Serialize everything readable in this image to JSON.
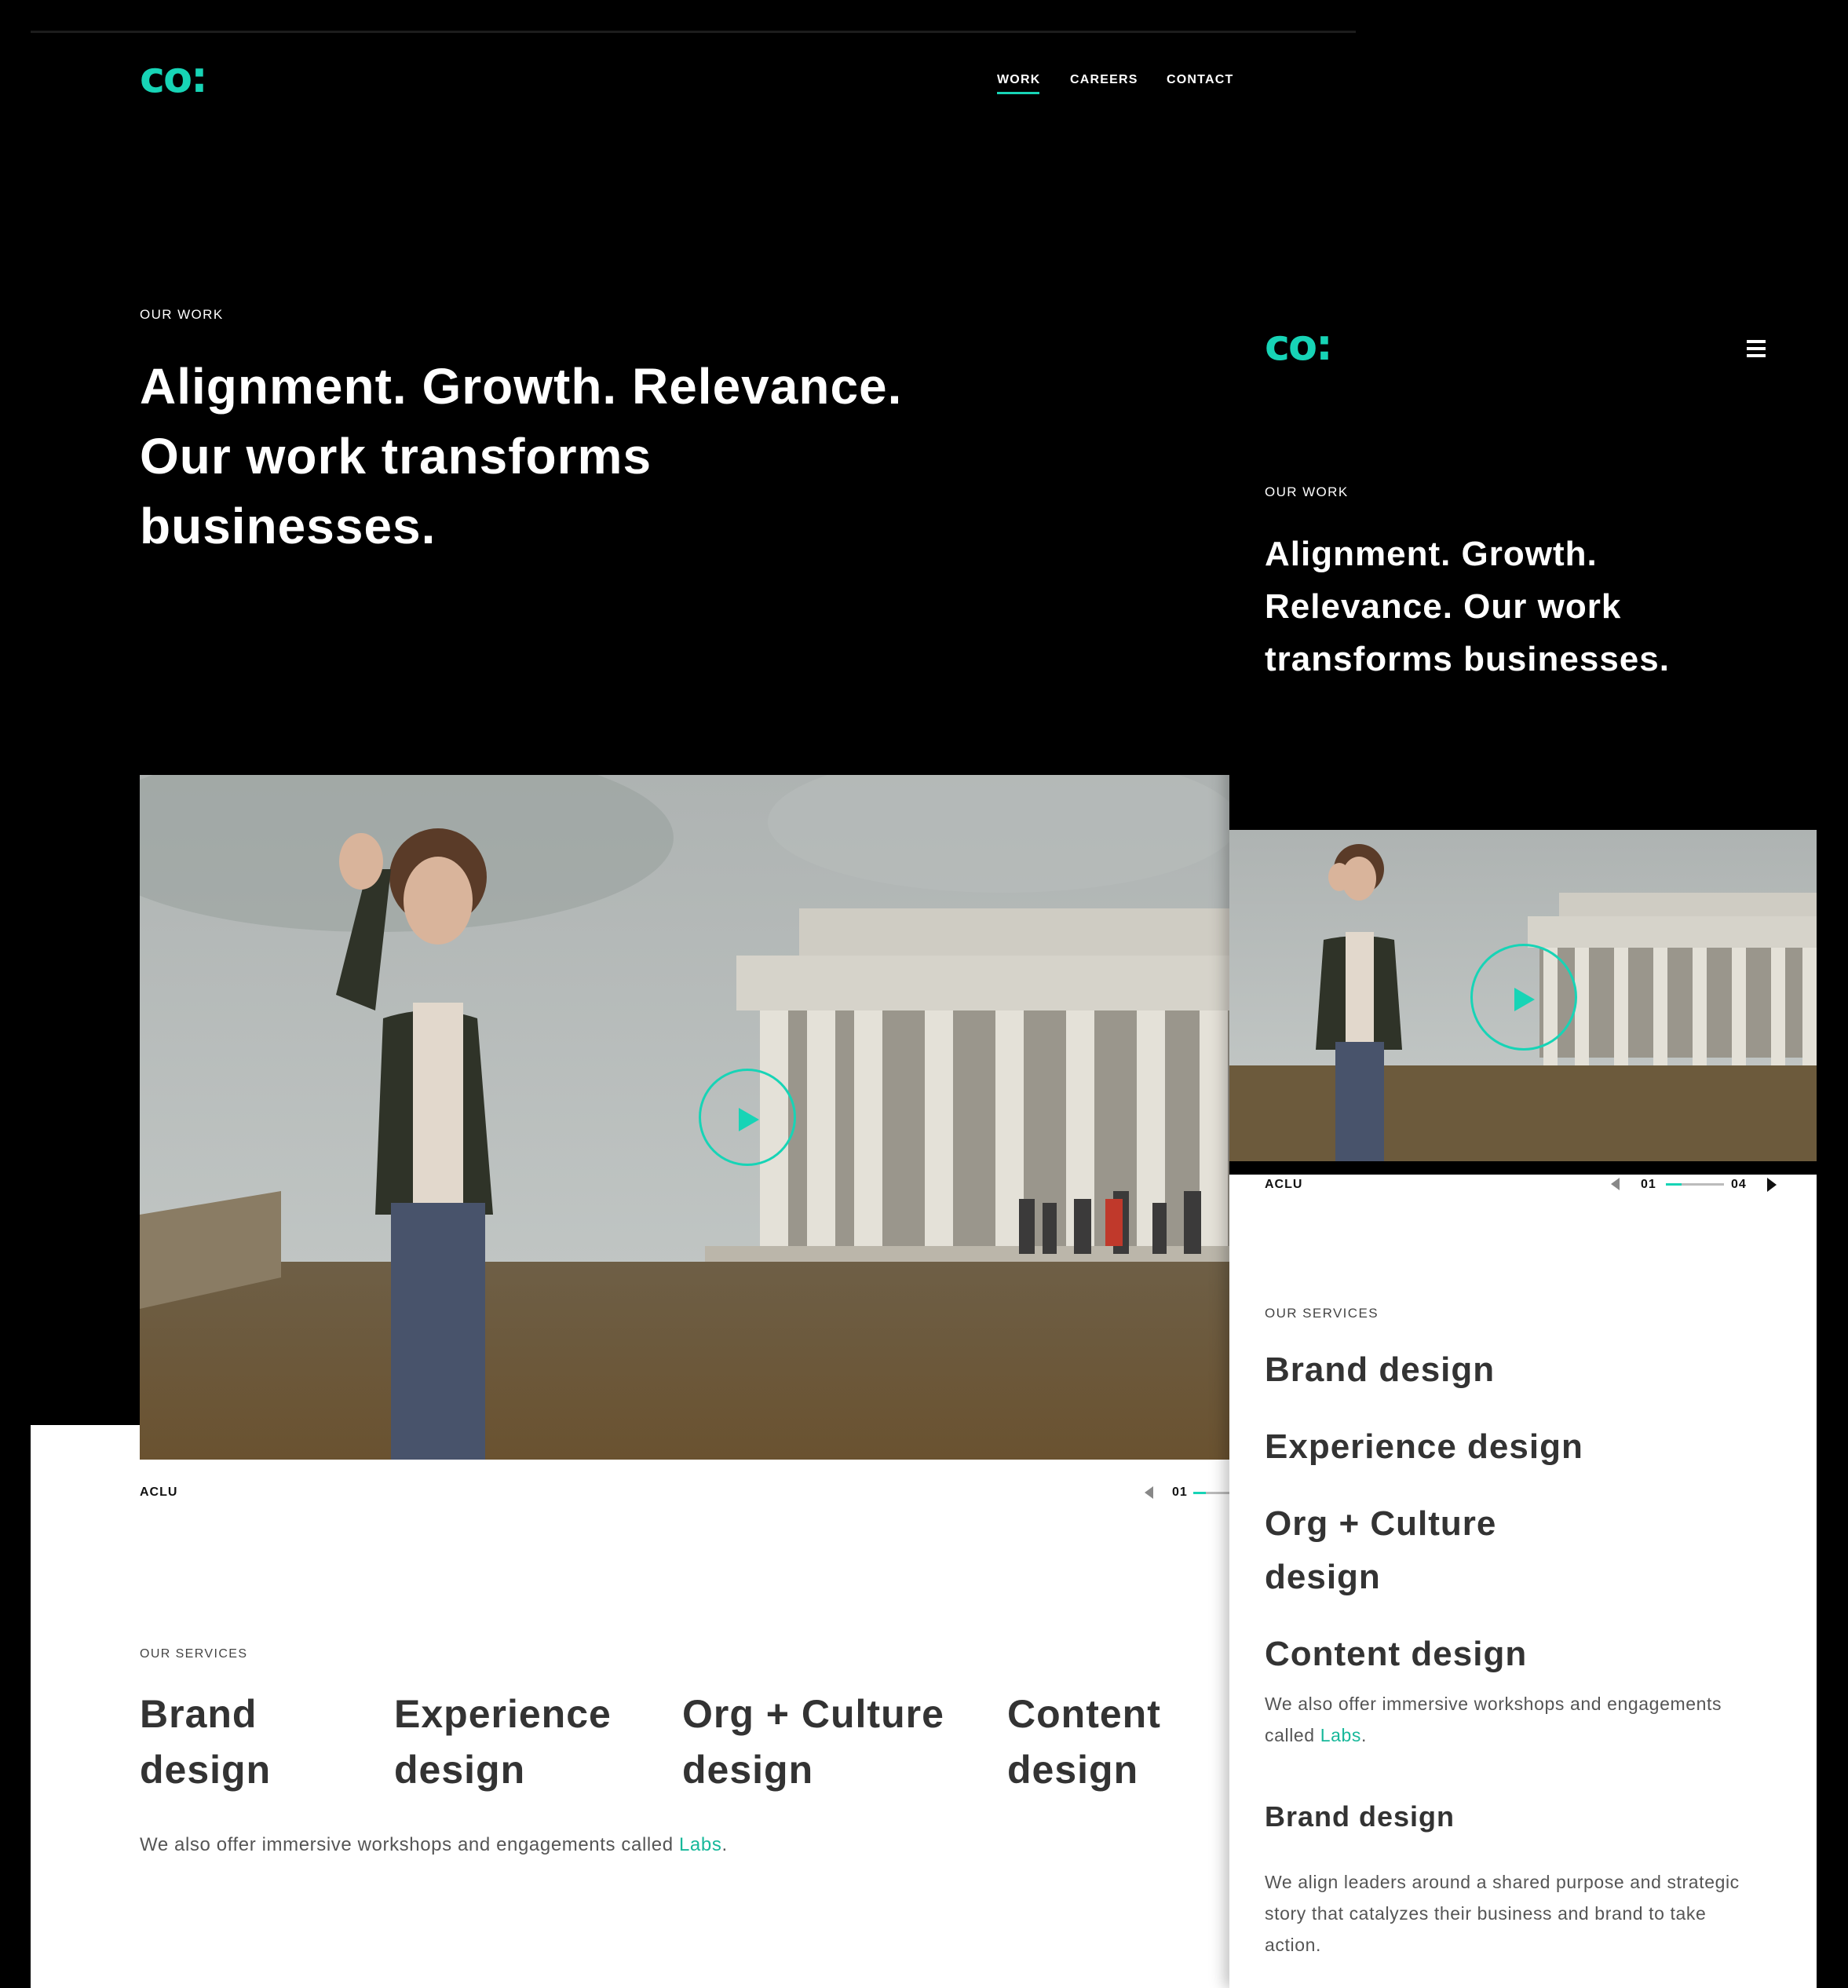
{
  "desktop": {
    "logo": "co:",
    "nav": {
      "work": "WORK",
      "careers": "CAREERS",
      "contact": "CONTACT"
    },
    "hero": {
      "eyebrow": "OUR WORK",
      "line1": "Alignment. Growth. Relevance.",
      "line2": "Our work transforms",
      "line3": "businesses."
    },
    "video": {
      "caption": "ACLU",
      "counter_current": "01"
    },
    "services": {
      "eyebrow": "OUR SERVICES",
      "items": [
        {
          "line1": "Brand",
          "line2": "design"
        },
        {
          "line1": "Experience",
          "line2": "design"
        },
        {
          "line1": "Org + Culture",
          "line2": "design"
        },
        {
          "line1": "Content",
          "line2": "design"
        }
      ],
      "note_prefix": "We also offer immersive workshops and engagements called ",
      "note_link": "Labs",
      "note_suffix": "."
    }
  },
  "mobile": {
    "logo": "co:",
    "menu_icon": "hamburger-icon",
    "hero": {
      "eyebrow": "OUR WORK",
      "line1": "Alignment. Growth.",
      "line2": "Relevance. Our work",
      "line3": "transforms businesses."
    },
    "video": {
      "caption": "ACLU",
      "counter_current": "01",
      "counter_total": "04"
    },
    "services": {
      "eyebrow": "OUR SERVICES",
      "items": [
        "Brand design",
        "Experience design",
        "Org + Culture",
        "design",
        "Content design"
      ],
      "note_prefix": "We also offer immersive workshops and engagements",
      "note_line2_prefix": "called ",
      "note_link": "Labs",
      "note_suffix": ".",
      "detail_title": "Brand design",
      "detail_lines": [
        "We align leaders around a shared purpose and strategic",
        "story that catalyzes their business and brand to take",
        "action."
      ]
    }
  },
  "colors": {
    "accent": "#17d4b6",
    "link": "#17b89a",
    "background": "#000000"
  }
}
